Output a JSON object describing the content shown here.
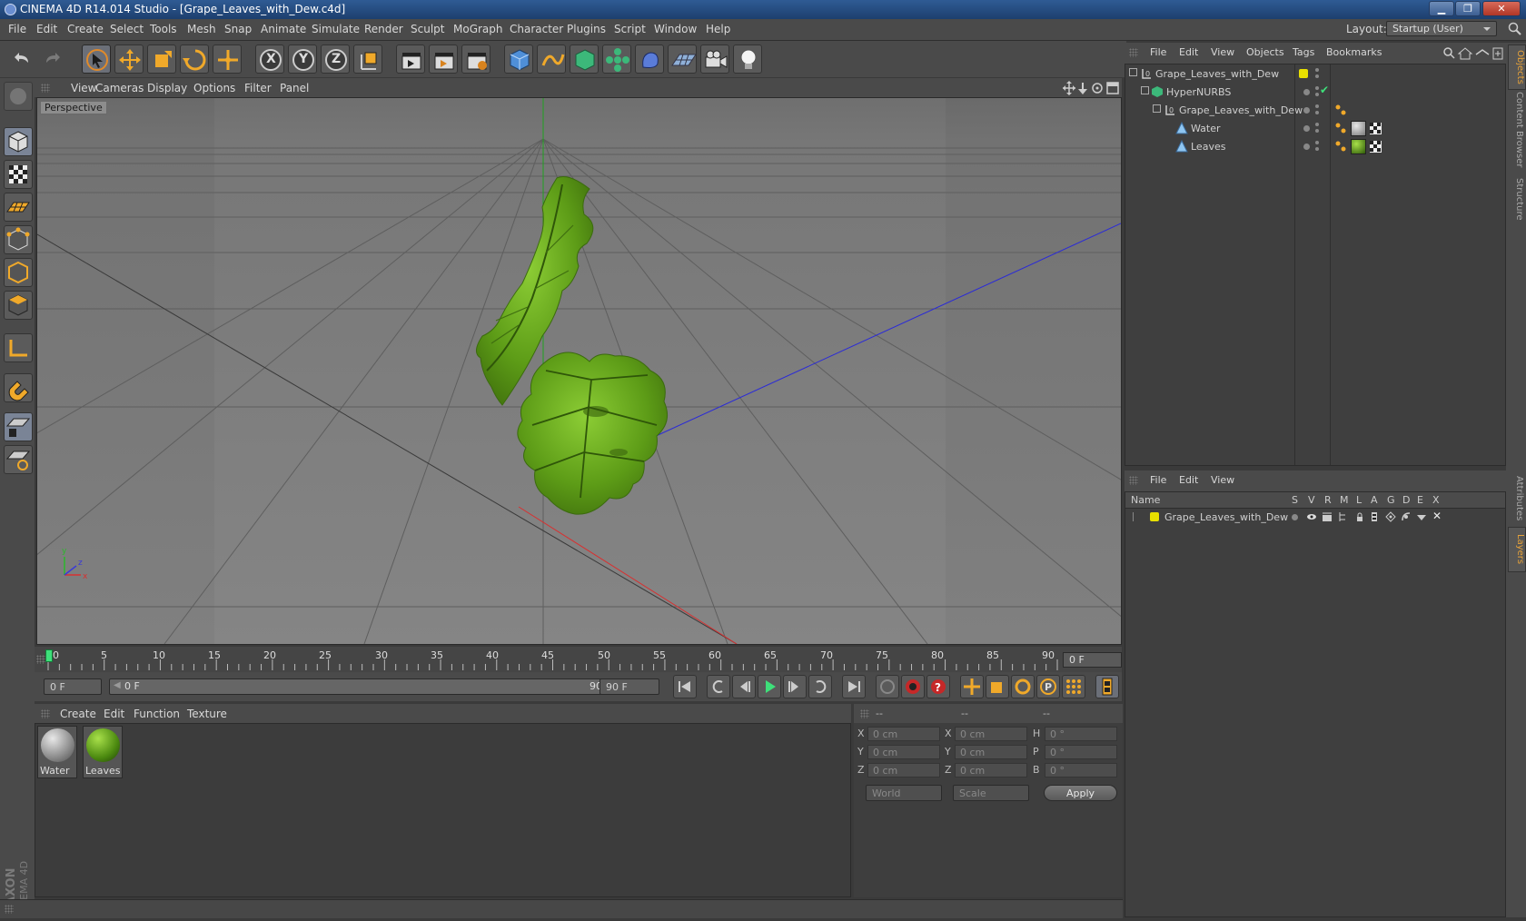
{
  "window": {
    "title": "CINEMA 4D R14.014 Studio - [Grape_Leaves_with_Dew.c4d]",
    "minimize": "▁",
    "maximize": "❐",
    "close": "✕"
  },
  "menubar": {
    "items": [
      "File",
      "Edit",
      "Create",
      "Select",
      "Tools",
      "Mesh",
      "Snap",
      "Animate",
      "Simulate",
      "Render",
      "Sculpt",
      "MoGraph",
      "Character",
      "Plugins",
      "Script",
      "Window",
      "Help"
    ],
    "layout_label": "Layout:",
    "layout_value": "Startup (User)"
  },
  "toolbar": {
    "axis_x": "X",
    "axis_y": "Y",
    "axis_z": "Z"
  },
  "viewport": {
    "menu": [
      "View",
      "Cameras",
      "Display",
      "Options",
      "Filter",
      "Panel"
    ],
    "label": "Perspective",
    "axis_y": "y",
    "axis_z": "z",
    "axis_x": "x"
  },
  "timeline": {
    "ticks": [
      "0",
      "5",
      "10",
      "15",
      "20",
      "25",
      "30",
      "35",
      "40",
      "45",
      "50",
      "55",
      "60",
      "65",
      "70",
      "75",
      "80",
      "85",
      "90"
    ],
    "current_frame": "0 F"
  },
  "transport": {
    "start_frame": "0 F",
    "range_start": "0 F",
    "range_end": "90 F",
    "end_frame": "90 F"
  },
  "materials": {
    "menu": [
      "Create",
      "Edit",
      "Function",
      "Texture"
    ],
    "items": [
      {
        "name": "Water"
      },
      {
        "name": "Leaves"
      }
    ]
  },
  "coordinates": {
    "headers": [
      "--",
      "--",
      "--"
    ],
    "rows": [
      {
        "l1": "X",
        "v1": "0 cm",
        "l2": "X",
        "v2": "0 cm",
        "l3": "H",
        "v3": "0 °"
      },
      {
        "l1": "Y",
        "v1": "0 cm",
        "l2": "Y",
        "v2": "0 cm",
        "l3": "P",
        "v3": "0 °"
      },
      {
        "l1": "Z",
        "v1": "0 cm",
        "l2": "Z",
        "v2": "0 cm",
        "l3": "B",
        "v3": "0 °"
      }
    ],
    "space": "World",
    "mode": "Scale",
    "apply": "Apply"
  },
  "objects": {
    "menu": [
      "File",
      "Edit",
      "View",
      "Objects",
      "Tags",
      "Bookmarks"
    ],
    "items": [
      {
        "name": "Grape_Leaves_with_Dew"
      },
      {
        "name": "HyperNURBS"
      },
      {
        "name": "Grape_Leaves_with_Dew"
      },
      {
        "name": "Water"
      },
      {
        "name": "Leaves"
      }
    ]
  },
  "layers": {
    "menu": [
      "File",
      "Edit",
      "View"
    ],
    "columns": [
      "Name",
      "S",
      "V",
      "R",
      "M",
      "L",
      "A",
      "G",
      "D",
      "E",
      "X"
    ],
    "items": [
      {
        "name": "Grape_Leaves_with_Dew"
      }
    ]
  },
  "right_tabs": [
    "Objects",
    "Content Browser",
    "Structure",
    "Attributes",
    "Layers"
  ],
  "colors": {
    "accent": "#e6a23a",
    "layer_yellow": "#e8e000",
    "leaf_green": "#6aa81c"
  }
}
